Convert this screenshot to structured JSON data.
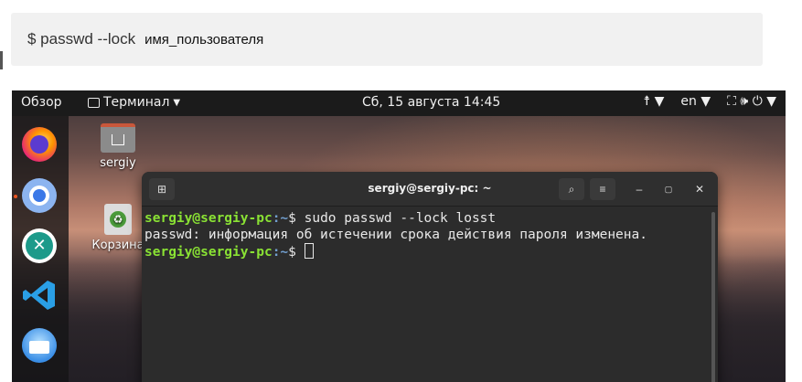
{
  "article": {
    "command": "$ passwd --lock",
    "argument": "имя_пользователя"
  },
  "topbar": {
    "overview": "Обзор",
    "app_name": "Терминал",
    "clock": "Сб, 15 августа  14:45",
    "lang": "en"
  },
  "desktop": {
    "home_label": "sergiy",
    "trash_label": "Корзина"
  },
  "terminal": {
    "title": "sergiy@sergiy-pc: ~",
    "line1_user": "sergiy@sergiy-pc",
    "line1_path": ":~",
    "line1_cmd": "$ sudo passwd --lock losst",
    "line2": "passwd: информация об истечении срока действия пароля изменена.",
    "line3_user": "sergiy@sergiy-pc",
    "line3_path": ":~",
    "line3_cmd": "$ "
  },
  "icons": {
    "dock": [
      "firefox-icon",
      "chromium-icon",
      "remmina-icon",
      "vscode-icon",
      "thunderbird-icon"
    ],
    "colors": {
      "accent": "#e95420",
      "prompt_user": "#8ae234",
      "prompt_path": "#729fcf"
    }
  }
}
